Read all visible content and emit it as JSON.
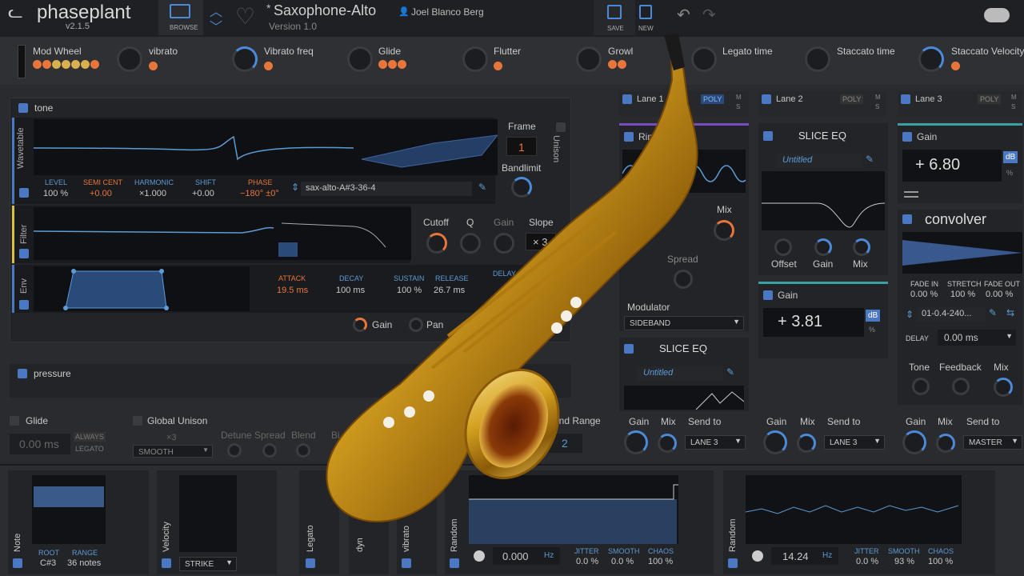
{
  "header": {
    "logo": "phaseplant",
    "version": "v2.1.5",
    "browse_label": "BROWSE",
    "save_label": "SAVE",
    "new_label": "NEW",
    "preset_name": "Saxophone-Alto",
    "preset_modified": "*",
    "preset_version": "Version 1.0",
    "author": "Joel Blanco Berg"
  },
  "macros": [
    "Mod Wheel",
    "vibrato",
    "Vibrato freq",
    "Glide",
    "Flutter",
    "Growl",
    "Legato time",
    "Staccato time",
    "Staccato Velocity"
  ],
  "tone": {
    "title": "tone",
    "wavetable": {
      "section": "Wavetable",
      "level_label": "LEVEL",
      "level": "100 %",
      "semi_label": "SEMI CENT",
      "semi": "+0.00",
      "harmonic_label": "HARMONIC",
      "harmonic": "×1.000",
      "shift_label": "SHIFT",
      "shift": "+0.00",
      "phase_label": "PHASE",
      "phase": "−180° ±0°",
      "file": "sax-alto-A#3-36-4",
      "frame_label": "Frame",
      "frame": "1",
      "bandlimit_label": "Bandlimit",
      "unison_label": "Unison"
    },
    "filter": {
      "section": "Filter",
      "cutoff_label": "Cutoff",
      "q_label": "Q",
      "gain_label": "Gain",
      "slope_label": "Slope",
      "slope": "× 3"
    },
    "env": {
      "section": "Env",
      "attack_label": "ATTACK",
      "attack": "19.5 ms",
      "decay_label": "DECAY",
      "decay": "100 ms",
      "sustain_label": "SUSTAIN",
      "sustain": "100 %",
      "release_label": "RELEASE",
      "release": "26.7 ms",
      "delay_label": "DELAY"
    },
    "gain_label": "Gain",
    "pan_label": "Pan"
  },
  "pressure_title": "pressure",
  "lanes": [
    {
      "name": "Lane 1",
      "mode": "POLY",
      "m": "M",
      "s": "S"
    },
    {
      "name": "Lane 2",
      "mode": "POLY",
      "m": "M",
      "s": "S"
    },
    {
      "name": "Lane 3",
      "mode": "POLY",
      "m": "M",
      "s": "S"
    }
  ],
  "lane1": {
    "ring_mod": "Ring Mod",
    "mix_label": "Mix",
    "spread_label": "Spread",
    "modulator_label": "Modulator",
    "modulator": "SIDEBAND",
    "slice_eq": "SLICE EQ",
    "untitled": "Untitled"
  },
  "lane2": {
    "slice_eq": "SLICE EQ",
    "untitled": "Untitled",
    "offset_label": "Offset",
    "gain_label": "Gain",
    "mix_label": "Mix",
    "gain_title": "Gain",
    "gain_value": "+ 3.81",
    "db": "dB",
    "pct": "%"
  },
  "lane3": {
    "gain_title": "Gain",
    "gain_value": "+ 6.80",
    "db": "dB",
    "pct": "%",
    "convolver": "convolver",
    "fade_in_label": "FADE IN",
    "fade_in": "0.00 %",
    "stretch_label": "STRETCH",
    "stretch": "100 %",
    "fade_out_label": "FADE OUT",
    "fade_out": "0.00 %",
    "ir_file": "01-0.4-240...",
    "delay_label": "DELAY",
    "delay": "0.00 ms",
    "tone_label": "Tone",
    "feedback_label": "Feedback",
    "mix_label": "Mix"
  },
  "sends": [
    {
      "gain": "Gain",
      "mix": "Mix",
      "send_to": "Send to",
      "target": "LANE 3"
    },
    {
      "gain": "Gain",
      "mix": "Mix",
      "send_to": "Send to",
      "target": "LANE 3"
    },
    {
      "gain": "Gain",
      "mix": "Mix",
      "send_to": "Send to",
      "target": "MASTER"
    }
  ],
  "glide": {
    "label": "Glide",
    "value": "0.00 ms",
    "always": "ALWAYS",
    "legato": "LEGATO"
  },
  "global_unison": {
    "label": "Global Unison",
    "count": "×3",
    "mode": "SMOOTH",
    "detune": "Detune",
    "spread": "Spread",
    "blend": "Blend",
    "bias": "Bi"
  },
  "bend_range": {
    "label": "Bend Range",
    "value": "2"
  },
  "modulators": {
    "note": {
      "label": "Note",
      "root_label": "ROOT",
      "root": "C#3",
      "range_label": "RANGE",
      "range": "36 notes"
    },
    "velocity": {
      "label": "Velocity",
      "mode": "STRIKE"
    },
    "legato": {
      "label": "Legato"
    },
    "dyn": {
      "label": "dyn"
    },
    "vibrato": {
      "label": "vibrato"
    },
    "random1": {
      "label": "Random",
      "rate": "0.000",
      "unit": "Hz",
      "jitter_label": "JITTER",
      "jitter": "0.0 %",
      "smooth_label": "SMOOTH",
      "smooth": "0.0 %",
      "chaos_label": "CHAOS",
      "chaos": "100 %"
    },
    "random2": {
      "label": "Random",
      "rate": "14.24",
      "unit": "Hz",
      "jitter_label": "JITTER",
      "jitter": "0.0 %",
      "smooth_label": "SMOOTH",
      "smooth": "93 %",
      "chaos_label": "CHAOS",
      "chaos": "100 %"
    }
  },
  "colors": {
    "accent": "#4a78c2",
    "orange": "#e8763a",
    "bg": "#2a2b2e",
    "panel": "#1c1d20"
  }
}
